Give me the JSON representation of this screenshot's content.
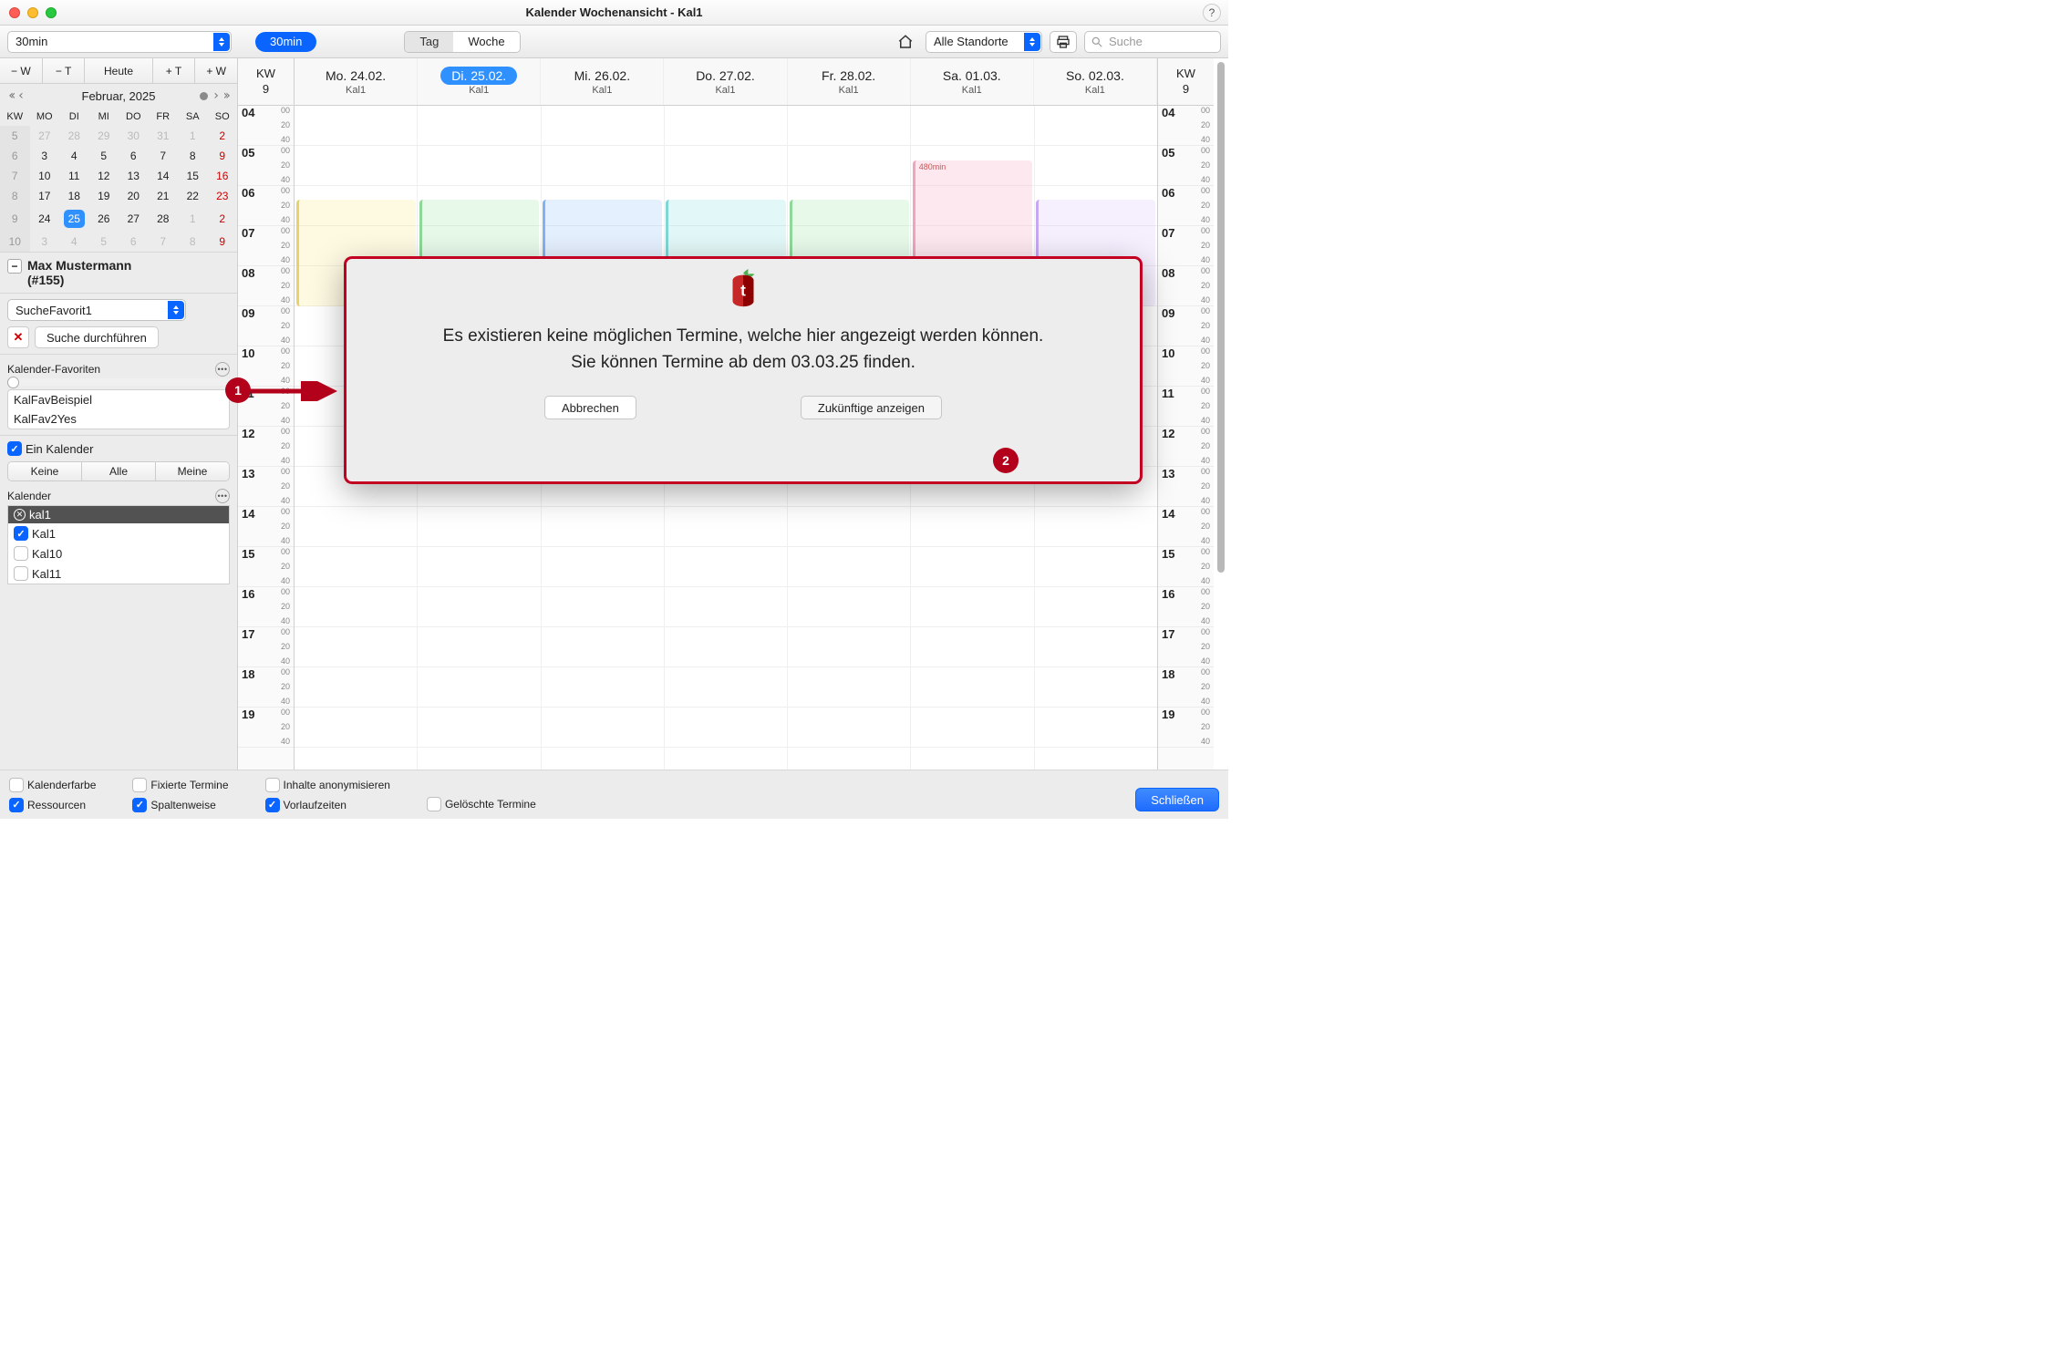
{
  "window_title": "Kalender Wochenansicht - Kal1",
  "toolbar": {
    "duration_select": "30min",
    "duration_pill": "30min",
    "view_seg": {
      "day": "Tag",
      "week": "Woche"
    },
    "location_select": "Alle Standorte",
    "search_placeholder": "Suche"
  },
  "weeknav": {
    "minus_w": "− W",
    "minus_t": "− T",
    "today": "Heute",
    "plus_t": "+ T",
    "plus_w": "+ W"
  },
  "month_label": "Februar, 2025",
  "mini_headers": [
    "KW",
    "MO",
    "DI",
    "MI",
    "DO",
    "FR",
    "SA",
    "SO"
  ],
  "mini_rows": [
    {
      "kw": "5",
      "d": [
        "27",
        "28",
        "29",
        "30",
        "31",
        "1",
        "2"
      ],
      "dim": [
        0,
        1,
        2,
        3,
        4
      ],
      "red": [
        6
      ]
    },
    {
      "kw": "6",
      "d": [
        "3",
        "4",
        "5",
        "6",
        "7",
        "8",
        "9"
      ],
      "red": [
        6
      ]
    },
    {
      "kw": "7",
      "d": [
        "10",
        "11",
        "12",
        "13",
        "14",
        "15",
        "16"
      ],
      "red": [
        6
      ]
    },
    {
      "kw": "8",
      "d": [
        "17",
        "18",
        "19",
        "20",
        "21",
        "22",
        "23"
      ],
      "red": [
        6
      ]
    },
    {
      "kw": "9",
      "d": [
        "24",
        "25",
        "26",
        "27",
        "28",
        "1",
        "2"
      ],
      "red": [
        6
      ],
      "sel": 1,
      "dim": [
        5,
        6
      ]
    },
    {
      "kw": "10",
      "d": [
        "3",
        "4",
        "5",
        "6",
        "7",
        "8",
        "9"
      ],
      "red": [
        6
      ],
      "dim": [
        0,
        1,
        2,
        3,
        4,
        5,
        6
      ]
    }
  ],
  "user": {
    "name": "Max Mustermann",
    "id": "(#155)"
  },
  "search_favorite": "SucheFavorit1",
  "search_button": "Suche durchführen",
  "kalfav_header": "Kalender-Favoriten",
  "kalfav_items": [
    "KalFavBeispiel",
    "KalFav2Yes"
  ],
  "single_cal": "Ein Kalender",
  "seg3": [
    "Keine",
    "Alle",
    "Meine"
  ],
  "kalender_header": "Kalender",
  "kal_selected": "kal1",
  "kal_items": [
    {
      "name": "Kal1",
      "checked": true
    },
    {
      "name": "Kal10",
      "checked": false
    },
    {
      "name": "Kal11",
      "checked": false
    }
  ],
  "week_header": {
    "kw_label": "KW",
    "kw_num": "9",
    "days": [
      {
        "h": "Mo. 24.02.",
        "sub": "Kal1"
      },
      {
        "h": "Di. 25.02.",
        "sub": "Kal1",
        "selected": true
      },
      {
        "h": "Mi. 26.02.",
        "sub": "Kal1"
      },
      {
        "h": "Do. 27.02.",
        "sub": "Kal1"
      },
      {
        "h": "Fr. 28.02.",
        "sub": "Kal1"
      },
      {
        "h": "Sa. 01.03.",
        "sub": "Kal1"
      },
      {
        "h": "So. 02.03.",
        "sub": "Kal1"
      }
    ]
  },
  "hours": [
    "04",
    "05",
    "06",
    "07",
    "08",
    "09",
    "10",
    "11",
    "12",
    "13",
    "14",
    "15",
    "16",
    "17",
    "18",
    "19"
  ],
  "minute_marks": [
    "00",
    "20",
    "40"
  ],
  "event_label": "480min",
  "dialog": {
    "line1": "Es existieren keine möglichen Termine, welche hier angezeigt werden können.",
    "line2": "Sie können Termine ab dem 03.03.25 finden.",
    "cancel": "Abbrechen",
    "future": "Zukünftige anzeigen"
  },
  "footer": {
    "kalenderfarbe": "Kalenderfarbe",
    "ressourcen": "Ressourcen",
    "fixierte": "Fixierte Termine",
    "spaltenweise": "Spaltenweise",
    "inhalte": "Inhalte anonymisieren",
    "vorlaufzeiten": "Vorlaufzeiten",
    "geloeschte": "Gelöschte Termine",
    "close": "Schließen"
  },
  "callouts": {
    "c1": "1",
    "c2": "2"
  }
}
